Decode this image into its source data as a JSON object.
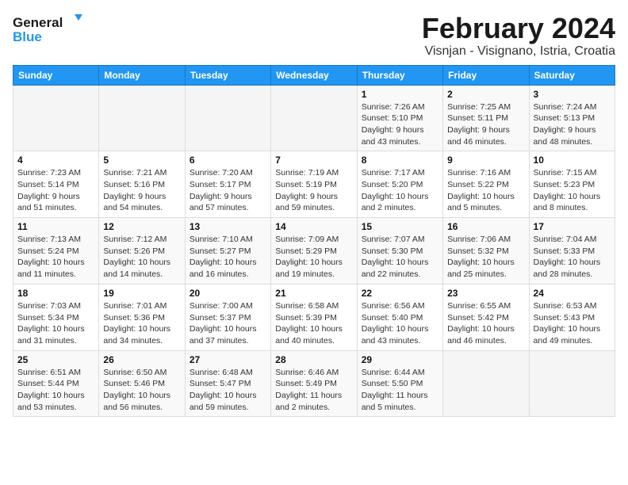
{
  "header": {
    "logo_line1": "General",
    "logo_line2": "Blue",
    "month_year": "February 2024",
    "location": "Visnjan - Visignano, Istria, Croatia"
  },
  "calendar": {
    "weekdays": [
      "Sunday",
      "Monday",
      "Tuesday",
      "Wednesday",
      "Thursday",
      "Friday",
      "Saturday"
    ],
    "weeks": [
      [
        {
          "day": "",
          "info": ""
        },
        {
          "day": "",
          "info": ""
        },
        {
          "day": "",
          "info": ""
        },
        {
          "day": "",
          "info": ""
        },
        {
          "day": "1",
          "info": "Sunrise: 7:26 AM\nSunset: 5:10 PM\nDaylight: 9 hours\nand 43 minutes."
        },
        {
          "day": "2",
          "info": "Sunrise: 7:25 AM\nSunset: 5:11 PM\nDaylight: 9 hours\nand 46 minutes."
        },
        {
          "day": "3",
          "info": "Sunrise: 7:24 AM\nSunset: 5:13 PM\nDaylight: 9 hours\nand 48 minutes."
        }
      ],
      [
        {
          "day": "4",
          "info": "Sunrise: 7:23 AM\nSunset: 5:14 PM\nDaylight: 9 hours\nand 51 minutes."
        },
        {
          "day": "5",
          "info": "Sunrise: 7:21 AM\nSunset: 5:16 PM\nDaylight: 9 hours\nand 54 minutes."
        },
        {
          "day": "6",
          "info": "Sunrise: 7:20 AM\nSunset: 5:17 PM\nDaylight: 9 hours\nand 57 minutes."
        },
        {
          "day": "7",
          "info": "Sunrise: 7:19 AM\nSunset: 5:19 PM\nDaylight: 9 hours\nand 59 minutes."
        },
        {
          "day": "8",
          "info": "Sunrise: 7:17 AM\nSunset: 5:20 PM\nDaylight: 10 hours\nand 2 minutes."
        },
        {
          "day": "9",
          "info": "Sunrise: 7:16 AM\nSunset: 5:22 PM\nDaylight: 10 hours\nand 5 minutes."
        },
        {
          "day": "10",
          "info": "Sunrise: 7:15 AM\nSunset: 5:23 PM\nDaylight: 10 hours\nand 8 minutes."
        }
      ],
      [
        {
          "day": "11",
          "info": "Sunrise: 7:13 AM\nSunset: 5:24 PM\nDaylight: 10 hours\nand 11 minutes."
        },
        {
          "day": "12",
          "info": "Sunrise: 7:12 AM\nSunset: 5:26 PM\nDaylight: 10 hours\nand 14 minutes."
        },
        {
          "day": "13",
          "info": "Sunrise: 7:10 AM\nSunset: 5:27 PM\nDaylight: 10 hours\nand 16 minutes."
        },
        {
          "day": "14",
          "info": "Sunrise: 7:09 AM\nSunset: 5:29 PM\nDaylight: 10 hours\nand 19 minutes."
        },
        {
          "day": "15",
          "info": "Sunrise: 7:07 AM\nSunset: 5:30 PM\nDaylight: 10 hours\nand 22 minutes."
        },
        {
          "day": "16",
          "info": "Sunrise: 7:06 AM\nSunset: 5:32 PM\nDaylight: 10 hours\nand 25 minutes."
        },
        {
          "day": "17",
          "info": "Sunrise: 7:04 AM\nSunset: 5:33 PM\nDaylight: 10 hours\nand 28 minutes."
        }
      ],
      [
        {
          "day": "18",
          "info": "Sunrise: 7:03 AM\nSunset: 5:34 PM\nDaylight: 10 hours\nand 31 minutes."
        },
        {
          "day": "19",
          "info": "Sunrise: 7:01 AM\nSunset: 5:36 PM\nDaylight: 10 hours\nand 34 minutes."
        },
        {
          "day": "20",
          "info": "Sunrise: 7:00 AM\nSunset: 5:37 PM\nDaylight: 10 hours\nand 37 minutes."
        },
        {
          "day": "21",
          "info": "Sunrise: 6:58 AM\nSunset: 5:39 PM\nDaylight: 10 hours\nand 40 minutes."
        },
        {
          "day": "22",
          "info": "Sunrise: 6:56 AM\nSunset: 5:40 PM\nDaylight: 10 hours\nand 43 minutes."
        },
        {
          "day": "23",
          "info": "Sunrise: 6:55 AM\nSunset: 5:42 PM\nDaylight: 10 hours\nand 46 minutes."
        },
        {
          "day": "24",
          "info": "Sunrise: 6:53 AM\nSunset: 5:43 PM\nDaylight: 10 hours\nand 49 minutes."
        }
      ],
      [
        {
          "day": "25",
          "info": "Sunrise: 6:51 AM\nSunset: 5:44 PM\nDaylight: 10 hours\nand 53 minutes."
        },
        {
          "day": "26",
          "info": "Sunrise: 6:50 AM\nSunset: 5:46 PM\nDaylight: 10 hours\nand 56 minutes."
        },
        {
          "day": "27",
          "info": "Sunrise: 6:48 AM\nSunset: 5:47 PM\nDaylight: 10 hours\nand 59 minutes."
        },
        {
          "day": "28",
          "info": "Sunrise: 6:46 AM\nSunset: 5:49 PM\nDaylight: 11 hours\nand 2 minutes."
        },
        {
          "day": "29",
          "info": "Sunrise: 6:44 AM\nSunset: 5:50 PM\nDaylight: 11 hours\nand 5 minutes."
        },
        {
          "day": "",
          "info": ""
        },
        {
          "day": "",
          "info": ""
        }
      ]
    ]
  }
}
